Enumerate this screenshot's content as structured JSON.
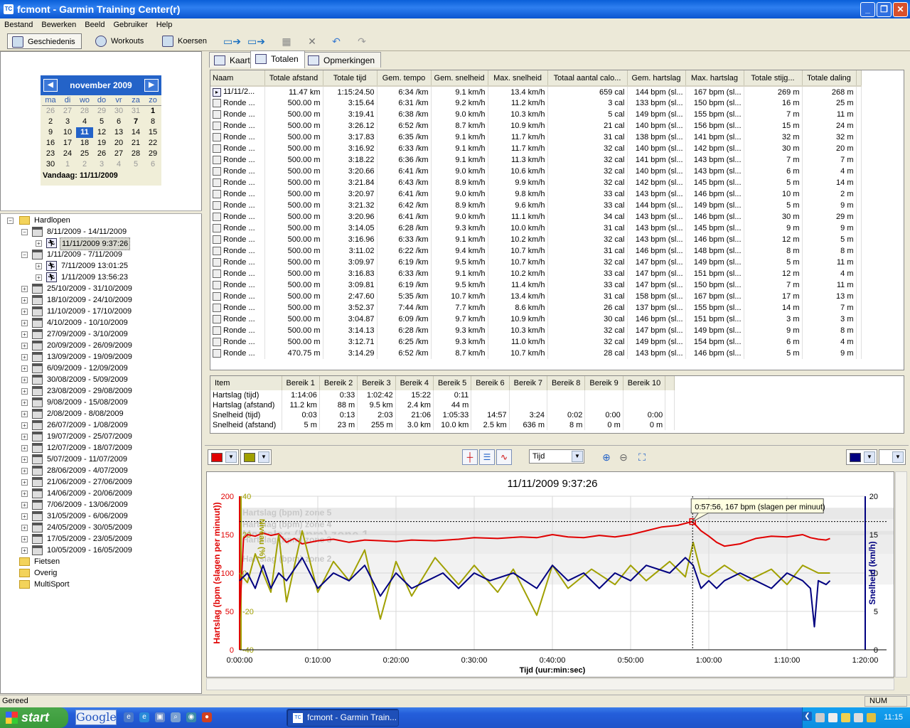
{
  "window": {
    "title": "fcmont - Garmin Training Center(r)",
    "app_icon": "TC"
  },
  "menu": [
    "Bestand",
    "Bewerken",
    "Beeld",
    "Gebruiker",
    "Help"
  ],
  "toolbar": {
    "history": "Geschiedenis",
    "workouts": "Workouts",
    "courses": "Koersen"
  },
  "calendar": {
    "month": "november 2009",
    "days_of_week": [
      "ma",
      "di",
      "wo",
      "do",
      "vr",
      "za",
      "zo"
    ],
    "weeks": [
      [
        "26",
        "27",
        "28",
        "29",
        "30",
        "31",
        "1"
      ],
      [
        "2",
        "3",
        "4",
        "5",
        "6",
        "7",
        "8"
      ],
      [
        "9",
        "10",
        "11",
        "12",
        "13",
        "14",
        "15"
      ],
      [
        "16",
        "17",
        "18",
        "19",
        "20",
        "21",
        "22"
      ],
      [
        "23",
        "24",
        "25",
        "26",
        "27",
        "28",
        "29"
      ],
      [
        "30",
        "1",
        "2",
        "3",
        "4",
        "5",
        "6"
      ]
    ],
    "today_label": "Vandaag: 11/11/2009"
  },
  "tree": [
    {
      "label": "Hardlopen",
      "level": 0,
      "type": "folder",
      "exp": "−"
    },
    {
      "label": "8/11/2009 - 14/11/2009",
      "level": 1,
      "type": "week",
      "exp": "−"
    },
    {
      "label": "11/11/2009 9:37:26",
      "level": 2,
      "type": "run",
      "exp": "+",
      "selected": true
    },
    {
      "label": "1/11/2009 - 7/11/2009",
      "level": 1,
      "type": "week",
      "exp": "−"
    },
    {
      "label": "7/11/2009 13:01:25",
      "level": 2,
      "type": "run",
      "exp": "+"
    },
    {
      "label": "1/11/2009 13:56:23",
      "level": 2,
      "type": "run",
      "exp": "+"
    },
    {
      "label": "25/10/2009 - 31/10/2009",
      "level": 1,
      "type": "week",
      "exp": "+"
    },
    {
      "label": "18/10/2009 - 24/10/2009",
      "level": 1,
      "type": "week",
      "exp": "+"
    },
    {
      "label": "11/10/2009 - 17/10/2009",
      "level": 1,
      "type": "week",
      "exp": "+"
    },
    {
      "label": "4/10/2009 - 10/10/2009",
      "level": 1,
      "type": "week",
      "exp": "+"
    },
    {
      "label": "27/09/2009 - 3/10/2009",
      "level": 1,
      "type": "week",
      "exp": "+"
    },
    {
      "label": "20/09/2009 - 26/09/2009",
      "level": 1,
      "type": "week",
      "exp": "+"
    },
    {
      "label": "13/09/2009 - 19/09/2009",
      "level": 1,
      "type": "week",
      "exp": "+"
    },
    {
      "label": "6/09/2009 - 12/09/2009",
      "level": 1,
      "type": "week",
      "exp": "+"
    },
    {
      "label": "30/08/2009 - 5/09/2009",
      "level": 1,
      "type": "week",
      "exp": "+"
    },
    {
      "label": "23/08/2009 - 29/08/2009",
      "level": 1,
      "type": "week",
      "exp": "+"
    },
    {
      "label": "9/08/2009 - 15/08/2009",
      "level": 1,
      "type": "week",
      "exp": "+"
    },
    {
      "label": "2/08/2009 - 8/08/2009",
      "level": 1,
      "type": "week",
      "exp": "+"
    },
    {
      "label": "26/07/2009 - 1/08/2009",
      "level": 1,
      "type": "week",
      "exp": "+"
    },
    {
      "label": "19/07/2009 - 25/07/2009",
      "level": 1,
      "type": "week",
      "exp": "+"
    },
    {
      "label": "12/07/2009 - 18/07/2009",
      "level": 1,
      "type": "week",
      "exp": "+"
    },
    {
      "label": "5/07/2009 - 11/07/2009",
      "level": 1,
      "type": "week",
      "exp": "+"
    },
    {
      "label": "28/06/2009 - 4/07/2009",
      "level": 1,
      "type": "week",
      "exp": "+"
    },
    {
      "label": "21/06/2009 - 27/06/2009",
      "level": 1,
      "type": "week",
      "exp": "+"
    },
    {
      "label": "14/06/2009 - 20/06/2009",
      "level": 1,
      "type": "week",
      "exp": "+"
    },
    {
      "label": "7/06/2009 - 13/06/2009",
      "level": 1,
      "type": "week",
      "exp": "+"
    },
    {
      "label": "31/05/2009 - 6/06/2009",
      "level": 1,
      "type": "week",
      "exp": "+"
    },
    {
      "label": "24/05/2009 - 30/05/2009",
      "level": 1,
      "type": "week",
      "exp": "+"
    },
    {
      "label": "17/05/2009 - 23/05/2009",
      "level": 1,
      "type": "week",
      "exp": "+"
    },
    {
      "label": "10/05/2009 - 16/05/2009",
      "level": 1,
      "type": "week",
      "exp": "+"
    },
    {
      "label": "Fietsen",
      "level": 0,
      "type": "folder",
      "exp": ""
    },
    {
      "label": "Overig",
      "level": 0,
      "type": "folder",
      "exp": ""
    },
    {
      "label": "MultiSport",
      "level": 0,
      "type": "folder",
      "exp": ""
    }
  ],
  "tabs": [
    "Kaart",
    "Totalen",
    "Opmerkingen"
  ],
  "laps": {
    "columns": [
      "Naam",
      "Totale afstand",
      "Totale tijd",
      "Gem. tempo",
      "Gem. snelheid",
      "Max. snelheid",
      "Totaal aantal calo...",
      "Gem. hartslag",
      "Max. hartslag",
      "Totale stijg...",
      "Totale daling"
    ],
    "rows": [
      [
        "11/11/2...",
        "11.47 km",
        "1:15:24.50",
        "6:34 /km",
        "9.1 km/h",
        "13.4 km/h",
        "659 cal",
        "144 bpm (sl...",
        "167 bpm (sl...",
        "269 m",
        "268 m"
      ],
      [
        "Ronde ...",
        "500.00 m",
        "3:15.64",
        "6:31 /km",
        "9.2 km/h",
        "11.2 km/h",
        "3 cal",
        "133 bpm (sl...",
        "150 bpm (sl...",
        "16 m",
        "25 m"
      ],
      [
        "Ronde ...",
        "500.00 m",
        "3:19.41",
        "6:38 /km",
        "9.0 km/h",
        "10.3 km/h",
        "5 cal",
        "149 bpm (sl...",
        "155 bpm (sl...",
        "7 m",
        "11 m"
      ],
      [
        "Ronde ...",
        "500.00 m",
        "3:26.12",
        "6:52 /km",
        "8.7 km/h",
        "10.9 km/h",
        "21 cal",
        "140 bpm (sl...",
        "156 bpm (sl...",
        "15 m",
        "24 m"
      ],
      [
        "Ronde ...",
        "500.00 m",
        "3:17.83",
        "6:35 /km",
        "9.1 km/h",
        "11.7 km/h",
        "31 cal",
        "138 bpm (sl...",
        "141 bpm (sl...",
        "32 m",
        "32 m"
      ],
      [
        "Ronde ...",
        "500.00 m",
        "3:16.92",
        "6:33 /km",
        "9.1 km/h",
        "11.7 km/h",
        "32 cal",
        "140 bpm (sl...",
        "142 bpm (sl...",
        "30 m",
        "20 m"
      ],
      [
        "Ronde ...",
        "500.00 m",
        "3:18.22",
        "6:36 /km",
        "9.1 km/h",
        "11.3 km/h",
        "32 cal",
        "141 bpm (sl...",
        "143 bpm (sl...",
        "7 m",
        "7 m"
      ],
      [
        "Ronde ...",
        "500.00 m",
        "3:20.66",
        "6:41 /km",
        "9.0 km/h",
        "10.6 km/h",
        "32 cal",
        "140 bpm (sl...",
        "143 bpm (sl...",
        "6 m",
        "4 m"
      ],
      [
        "Ronde ...",
        "500.00 m",
        "3:21.84",
        "6:43 /km",
        "8.9 km/h",
        "9.9 km/h",
        "32 cal",
        "142 bpm (sl...",
        "145 bpm (sl...",
        "5 m",
        "14 m"
      ],
      [
        "Ronde ...",
        "500.00 m",
        "3:20.97",
        "6:41 /km",
        "9.0 km/h",
        "9.8 km/h",
        "33 cal",
        "143 bpm (sl...",
        "146 bpm (sl...",
        "10 m",
        "2 m"
      ],
      [
        "Ronde ...",
        "500.00 m",
        "3:21.32",
        "6:42 /km",
        "8.9 km/h",
        "9.6 km/h",
        "33 cal",
        "144 bpm (sl...",
        "149 bpm (sl...",
        "5 m",
        "9 m"
      ],
      [
        "Ronde ...",
        "500.00 m",
        "3:20.96",
        "6:41 /km",
        "9.0 km/h",
        "11.1 km/h",
        "34 cal",
        "143 bpm (sl...",
        "146 bpm (sl...",
        "30 m",
        "29 m"
      ],
      [
        "Ronde ...",
        "500.00 m",
        "3:14.05",
        "6:28 /km",
        "9.3 km/h",
        "10.0 km/h",
        "31 cal",
        "143 bpm (sl...",
        "145 bpm (sl...",
        "9 m",
        "9 m"
      ],
      [
        "Ronde ...",
        "500.00 m",
        "3:16.96",
        "6:33 /km",
        "9.1 km/h",
        "10.2 km/h",
        "32 cal",
        "143 bpm (sl...",
        "146 bpm (sl...",
        "12 m",
        "5 m"
      ],
      [
        "Ronde ...",
        "500.00 m",
        "3:11.02",
        "6:22 /km",
        "9.4 km/h",
        "10.7 km/h",
        "31 cal",
        "146 bpm (sl...",
        "148 bpm (sl...",
        "8 m",
        "8 m"
      ],
      [
        "Ronde ...",
        "500.00 m",
        "3:09.97",
        "6:19 /km",
        "9.5 km/h",
        "10.7 km/h",
        "32 cal",
        "147 bpm (sl...",
        "149 bpm (sl...",
        "5 m",
        "11 m"
      ],
      [
        "Ronde ...",
        "500.00 m",
        "3:16.83",
        "6:33 /km",
        "9.1 km/h",
        "10.2 km/h",
        "33 cal",
        "147 bpm (sl...",
        "151 bpm (sl...",
        "12 m",
        "4 m"
      ],
      [
        "Ronde ...",
        "500.00 m",
        "3:09.81",
        "6:19 /km",
        "9.5 km/h",
        "11.4 km/h",
        "33 cal",
        "147 bpm (sl...",
        "150 bpm (sl...",
        "7 m",
        "11 m"
      ],
      [
        "Ronde ...",
        "500.00 m",
        "2:47.60",
        "5:35 /km",
        "10.7 km/h",
        "13.4 km/h",
        "31 cal",
        "158 bpm (sl...",
        "167 bpm (sl...",
        "17 m",
        "13 m"
      ],
      [
        "Ronde ...",
        "500.00 m",
        "3:52.37",
        "7:44 /km",
        "7.7 km/h",
        "8.6 km/h",
        "26 cal",
        "137 bpm (sl...",
        "155 bpm (sl...",
        "14 m",
        "7 m"
      ],
      [
        "Ronde ...",
        "500.00 m",
        "3:04.87",
        "6:09 /km",
        "9.7 km/h",
        "10.9 km/h",
        "30 cal",
        "146 bpm (sl...",
        "151 bpm (sl...",
        "3 m",
        "3 m"
      ],
      [
        "Ronde ...",
        "500.00 m",
        "3:14.13",
        "6:28 /km",
        "9.3 km/h",
        "10.3 km/h",
        "32 cal",
        "147 bpm (sl...",
        "149 bpm (sl...",
        "9 m",
        "8 m"
      ],
      [
        "Ronde ...",
        "500.00 m",
        "3:12.71",
        "6:25 /km",
        "9.3 km/h",
        "11.0 km/h",
        "32 cal",
        "149 bpm (sl...",
        "154 bpm (sl...",
        "6 m",
        "4 m"
      ],
      [
        "Ronde ...",
        "470.75 m",
        "3:14.29",
        "6:52 /km",
        "8.7 km/h",
        "10.7 km/h",
        "28 cal",
        "143 bpm (sl...",
        "146 bpm (sl...",
        "5 m",
        "9 m"
      ]
    ]
  },
  "zones": {
    "columns": [
      "Item",
      "Bereik 1",
      "Bereik 2",
      "Bereik 3",
      "Bereik 4",
      "Bereik 5",
      "Bereik 6",
      "Bereik 7",
      "Bereik 8",
      "Bereik 9",
      "Bereik 10"
    ],
    "rows": [
      [
        "Hartslag (tijd)",
        "1:14:06",
        "0:33",
        "1:02:42",
        "15:22",
        "0:11",
        "",
        "",
        "",
        "",
        ""
      ],
      [
        "Hartslag (afstand)",
        "11.2 km",
        "88 m",
        "9.5 km",
        "2.4 km",
        "44 m",
        "",
        "",
        "",
        "",
        ""
      ],
      [
        "Snelheid (tijd)",
        "0:03",
        "0:13",
        "2:03",
        "21:06",
        "1:05:33",
        "14:57",
        "3:24",
        "0:02",
        "0:00",
        "0:00"
      ],
      [
        "Snelheid (afstand)",
        "5 m",
        "23 m",
        "255 m",
        "3.0 km",
        "10.0 km",
        "2.5 km",
        "636 m",
        "8 m",
        "0 m",
        "0 m"
      ]
    ]
  },
  "graph_toolbar": {
    "x_axis_select": "Tijd",
    "series1_color": "#e00000",
    "series2_color": "#a0a000",
    "series3_color": "#000080"
  },
  "chart_data": {
    "type": "line",
    "title": "11/11/2009 9:37:26",
    "xlabel": "Tijd (uur:min:sec)",
    "x_ticks": [
      "0:00:00",
      "0:10:00",
      "0:20:00",
      "0:30:00",
      "0:40:00",
      "0:50:00",
      "1:00:00",
      "1:10:00",
      "1:20:00"
    ],
    "xlim_minutes": [
      0,
      80
    ],
    "y_left": {
      "label": "Hartslag (bpm (slagen per minuut))",
      "ticks": [
        "0",
        "50",
        "100",
        "150",
        "200"
      ],
      "range": [
        0,
        200
      ],
      "color": "#e00000"
    },
    "y_mid": {
      "label": "Niveau (%)",
      "ticks": [
        "-40",
        "-20",
        "0",
        "20",
        "40"
      ],
      "range": [
        -40,
        40
      ],
      "color": "#a0a000"
    },
    "y_right": {
      "label": "Snelheid (km/h)",
      "ticks": [
        "0",
        "5",
        "10",
        "15",
        "20"
      ],
      "range": [
        0,
        20
      ],
      "color": "#000080"
    },
    "zones": [
      {
        "label": "Hartslag (bpm) zone 5",
        "from": 170,
        "to": 185
      },
      {
        "label": "Hartslag (bpm) zone 4",
        "from": 155,
        "to": 170
      },
      {
        "label": "Hartslag (bpm) zone 1",
        "from": 150,
        "to": 155
      },
      {
        "label": "Hartslag (bpm) zone 3",
        "from": 125,
        "to": 150
      },
      {
        "label": "Hartslag (bpm) zone 2",
        "from": 85,
        "to": 125
      }
    ],
    "series": [
      {
        "name": "Hartslag",
        "axis": "left",
        "color": "#e00000",
        "x": [
          0,
          0.5,
          1,
          2,
          3,
          4,
          5,
          6,
          7,
          8,
          10,
          12,
          14,
          16,
          18,
          20,
          22,
          25,
          28,
          30,
          33,
          36,
          38,
          40,
          42,
          44,
          46,
          48,
          50,
          52,
          54,
          56,
          57.9,
          59,
          60,
          61,
          62,
          64,
          66,
          68,
          70,
          72,
          73,
          74,
          75,
          75.5
        ],
        "y": [
          40,
          145,
          150,
          148,
          152,
          149,
          151,
          140,
          145,
          138,
          142,
          144,
          140,
          143,
          142,
          141,
          143,
          142,
          144,
          146,
          145,
          147,
          146,
          150,
          147,
          146,
          149,
          147,
          150,
          155,
          160,
          162,
          167,
          155,
          148,
          140,
          135,
          138,
          145,
          148,
          147,
          150,
          146,
          144,
          143,
          145
        ]
      },
      {
        "name": "Niveau",
        "axis": "mid",
        "color": "#a0a000",
        "x": [
          0,
          1,
          2,
          4,
          5,
          6,
          8,
          10,
          12,
          14,
          16,
          18,
          20,
          22,
          25,
          28,
          30,
          33,
          35,
          38,
          40,
          42,
          45,
          48,
          50,
          52,
          55,
          57,
          58,
          59,
          60,
          62,
          65,
          68,
          70,
          72,
          74,
          75.5
        ],
        "y": [
          0,
          -5,
          10,
          -10,
          20,
          -15,
          22,
          -10,
          6,
          -4,
          12,
          -24,
          6,
          -12,
          8,
          -6,
          4,
          -10,
          2,
          -22,
          4,
          -8,
          2,
          -6,
          4,
          -4,
          6,
          -2,
          16,
          0,
          -2,
          4,
          -4,
          2,
          -6,
          4,
          0,
          0
        ]
      },
      {
        "name": "Snelheid",
        "axis": "right",
        "color": "#000080",
        "x": [
          0,
          1,
          2,
          3,
          4,
          5,
          6,
          8,
          10,
          12,
          14,
          16,
          18,
          20,
          22,
          24,
          26,
          28,
          30,
          32,
          35,
          38,
          40,
          42,
          44,
          46,
          48,
          50,
          52,
          55,
          57,
          58,
          59,
          60,
          61,
          62,
          64,
          66,
          68,
          70,
          72,
          73,
          73.5,
          74,
          75,
          75.5
        ],
        "y": [
          9,
          10,
          8,
          11,
          8,
          10,
          9,
          12,
          8,
          10,
          9,
          11,
          7,
          10,
          8,
          9,
          10,
          8,
          10,
          9,
          10,
          8,
          11,
          9,
          10,
          8,
          10,
          9,
          11,
          10,
          12,
          11,
          8,
          9,
          8,
          9,
          10,
          9,
          8,
          10,
          9,
          8,
          3,
          9,
          8.5,
          9
        ]
      }
    ],
    "annotation": "0:57:56, 167 bpm (slagen per minuut)",
    "cursor": {
      "x": 57.93,
      "y": 167
    },
    "grid": true
  },
  "status": {
    "left": "Gereed",
    "right": "NUM"
  },
  "taskbar": {
    "start": "start",
    "google": "Google",
    "window_button": "fcmont - Garmin Train...",
    "clock": "11:15"
  }
}
